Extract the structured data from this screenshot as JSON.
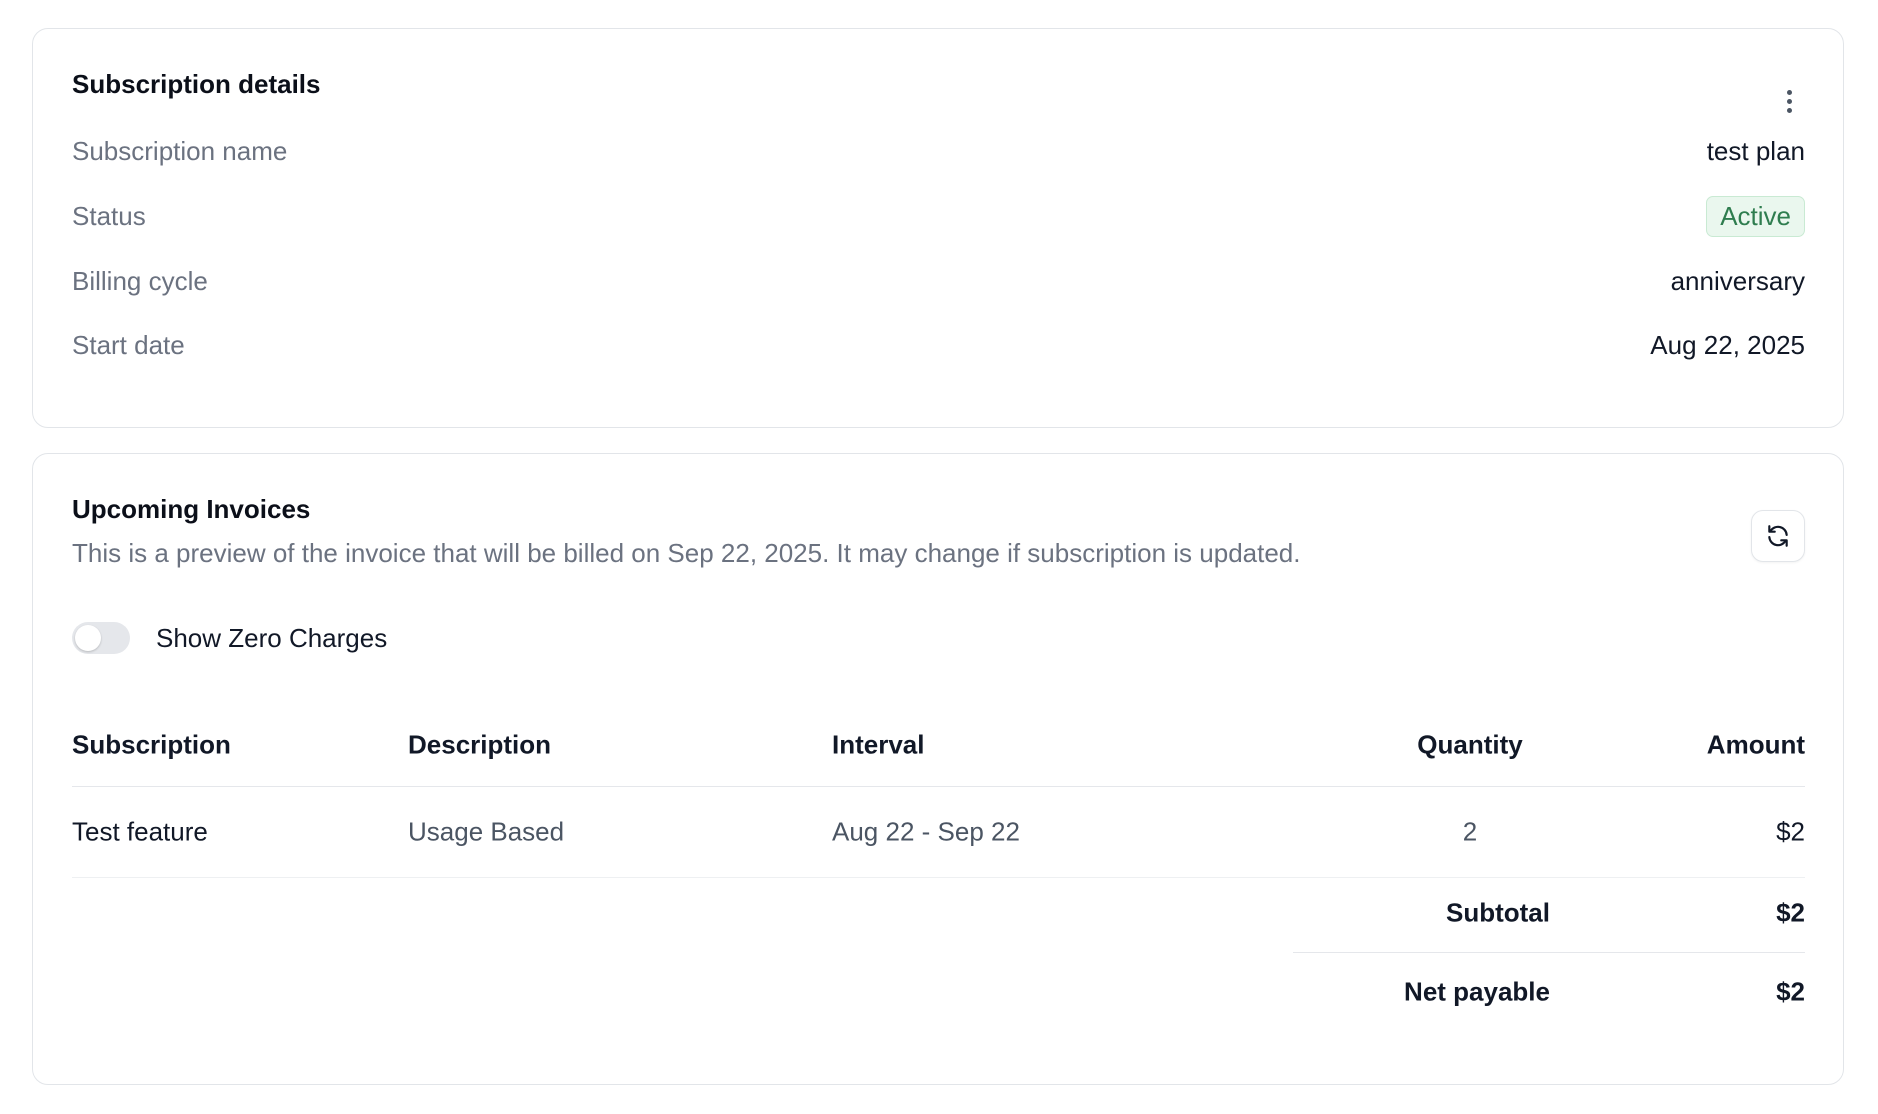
{
  "subscription_details": {
    "title": "Subscription details",
    "rows": [
      {
        "label": "Subscription name",
        "value": "test plan"
      },
      {
        "label": "Status",
        "value": "Active"
      },
      {
        "label": "Billing cycle",
        "value": "anniversary"
      },
      {
        "label": "Start date",
        "value": "Aug 22, 2025"
      }
    ],
    "menu_icon": "kebab-vertical-icon"
  },
  "upcoming_invoices": {
    "title": "Upcoming Invoices",
    "subtitle": "This is a preview of the invoice that will be billed on Sep 22, 2025. It may change if subscription is updated.",
    "refresh_icon": "refresh-icon",
    "toggle": {
      "label": "Show Zero Charges",
      "checked": false
    },
    "table": {
      "headers": [
        "Subscription",
        "Description",
        "Interval",
        "Quantity",
        "Amount"
      ],
      "rows": [
        {
          "subscription": "Test feature",
          "description": "Usage Based",
          "interval": "Aug 22 - Sep 22",
          "quantity": "2",
          "amount": "$2"
        }
      ]
    },
    "totals": {
      "subtotal_label": "Subtotal",
      "subtotal_value": "$2",
      "net_label": "Net payable",
      "net_value": "$2"
    }
  },
  "colors": {
    "status_active_text": "#2f7d4f",
    "status_active_bg": "#eaf7ee",
    "border": "#e2e5e9",
    "muted_text": "#6b7280"
  }
}
